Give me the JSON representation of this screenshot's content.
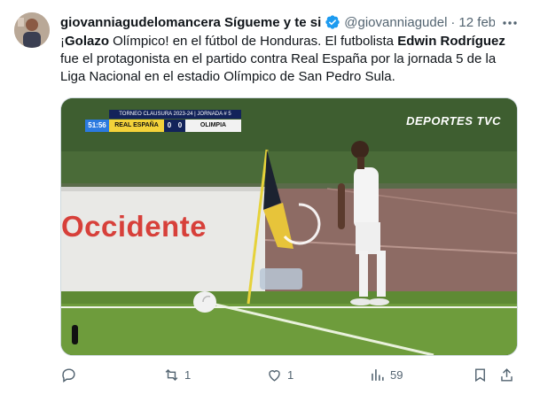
{
  "author": {
    "name": "giovanniagudelomancera Sígueme y te si",
    "handle": "@giovanniagudel",
    "date": "12 feb."
  },
  "tweet": {
    "t1": "¡",
    "t2": "Golazo",
    "t3": " Olímpico! en el fútbol de  Honduras. El futbolista ",
    "t4": "Edwin Rodríguez",
    "t5": " fue el protagonista en el partido contra Real España por la jornada 5 de la Liga Nacional en el estadio Olímpico de San Pedro Sula."
  },
  "video": {
    "watermark": "DEPORTES TVC",
    "scorebug": {
      "tournament": "TORNEO CLAUSURA 2023-24 | JORNADA # 5",
      "clock": "51:56",
      "home": "REAL ESPAÑA",
      "home_score": "0",
      "away_score": "0",
      "away": "OLIMPIA"
    },
    "ad_text": "Occidente"
  },
  "actions": {
    "replies": "",
    "reposts": "1",
    "likes": "1",
    "views": "59"
  },
  "icons": [
    "more-icon",
    "verified-icon",
    "reply-icon",
    "repost-icon",
    "like-icon",
    "views-icon",
    "bookmark-icon",
    "share-icon"
  ],
  "colors": {
    "verified": "#1d9bf0",
    "secondary_text": "#536471",
    "text": "#0f1419"
  }
}
